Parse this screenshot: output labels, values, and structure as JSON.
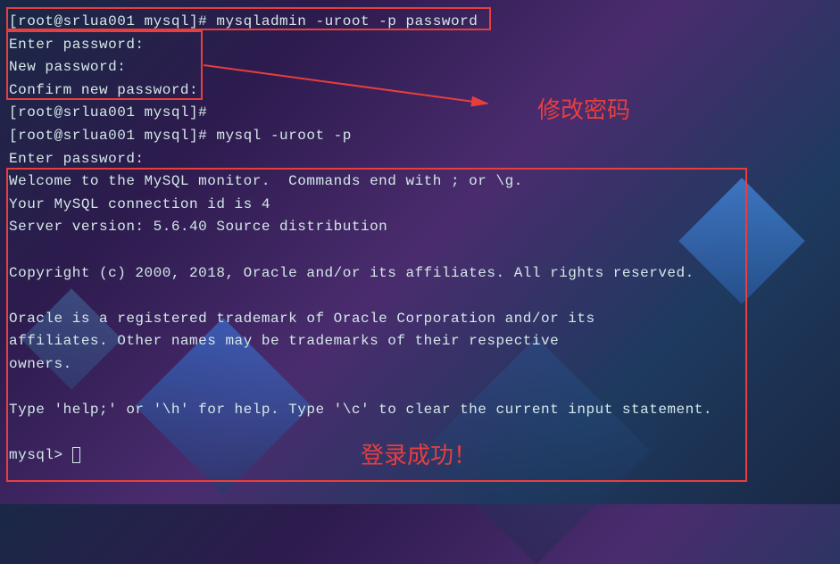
{
  "prompt1": "[root@srlua001 mysql]# ",
  "cmd1": "mysqladmin -uroot -p password",
  "enter_pw": "Enter password:",
  "new_pw": "New password:",
  "confirm_pw": "Confirm new password:",
  "prompt2": "[root@srlua001 mysql]#",
  "prompt3": "[root@srlua001 mysql]# ",
  "cmd2": "mysql -uroot -p",
  "enter_pw2": "Enter password:",
  "welcome1": "Welcome to the MySQL monitor.  Commands end with ; or \\g.",
  "welcome2": "Your MySQL connection id is 4",
  "welcome3": "Server version: 5.6.40 Source distribution",
  "copyright": "Copyright (c) 2000, 2018, Oracle and/or its affiliates. All rights reserved.",
  "trademark1": "Oracle is a registered trademark of Oracle Corporation and/or its",
  "trademark2": "affiliates. Other names may be trademarks of their respective",
  "trademark3": "owners.",
  "help": "Type 'help;' or '\\h' for help. Type '\\c' to clear the current input statement.",
  "mysql_prompt": "mysql> ",
  "annotation1": "修改密码",
  "annotation2": "登录成功！"
}
